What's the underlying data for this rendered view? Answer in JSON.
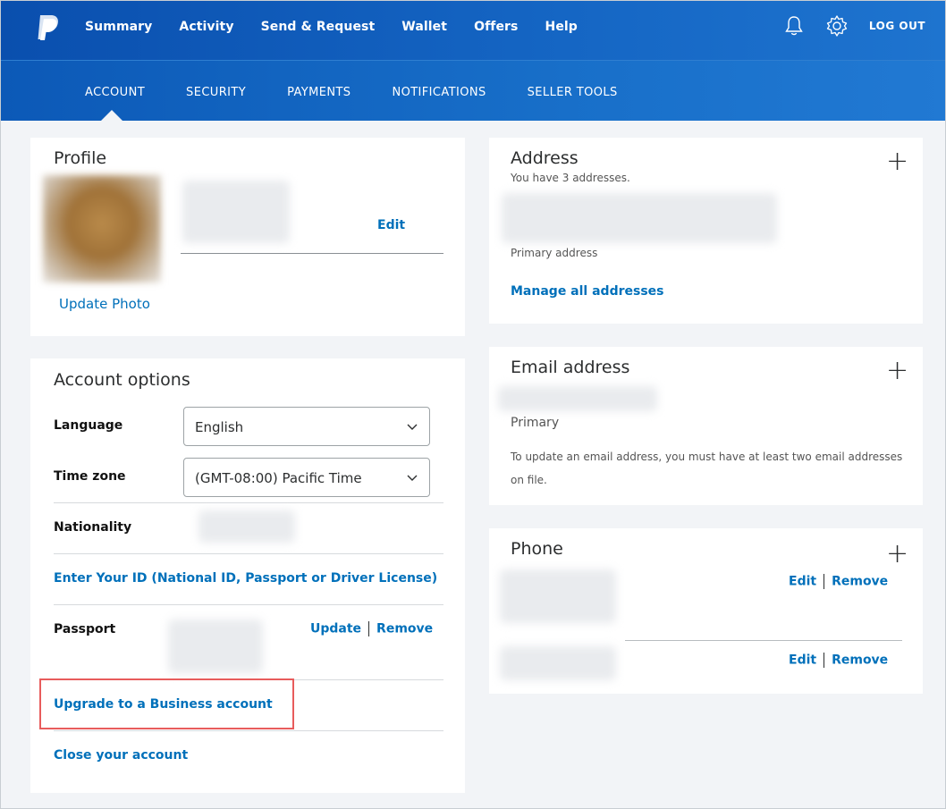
{
  "nav": {
    "items": [
      "Summary",
      "Activity",
      "Send & Request",
      "Wallet",
      "Offers",
      "Help"
    ],
    "logout": "LOG OUT",
    "icons": [
      "paypal-logo",
      "bell-icon",
      "gear-icon"
    ]
  },
  "subnav": {
    "items": [
      "ACCOUNT",
      "SECURITY",
      "PAYMENTS",
      "NOTIFICATIONS",
      "SELLER TOOLS"
    ],
    "active": "ACCOUNT"
  },
  "profile": {
    "title": "Profile",
    "edit": "Edit",
    "update_photo": "Update Photo"
  },
  "account_options": {
    "title": "Account options",
    "language_label": "Language",
    "language_value": "English",
    "timezone_label": "Time zone",
    "timezone_value": "(GMT-08:00) Pacific Time",
    "nationality_label": "Nationality",
    "enter_id": "Enter Your ID (National ID, Passport or Driver License)",
    "passport_label": "Passport",
    "update": "Update",
    "remove": "Remove",
    "upgrade": "Upgrade to a Business account",
    "close": "Close your account"
  },
  "address": {
    "title": "Address",
    "count_text": "You have 3 addresses.",
    "primary": "Primary address",
    "manage": "Manage all addresses"
  },
  "email": {
    "title": "Email address",
    "primary": "Primary",
    "note": "To update an email address, you must have at least two email addresses on file."
  },
  "phone": {
    "title": "Phone",
    "edit": "Edit",
    "remove": "Remove"
  },
  "colors": {
    "brand": "#0070ba",
    "nav": "#0a4fae",
    "highlight": "#e85c5c"
  }
}
